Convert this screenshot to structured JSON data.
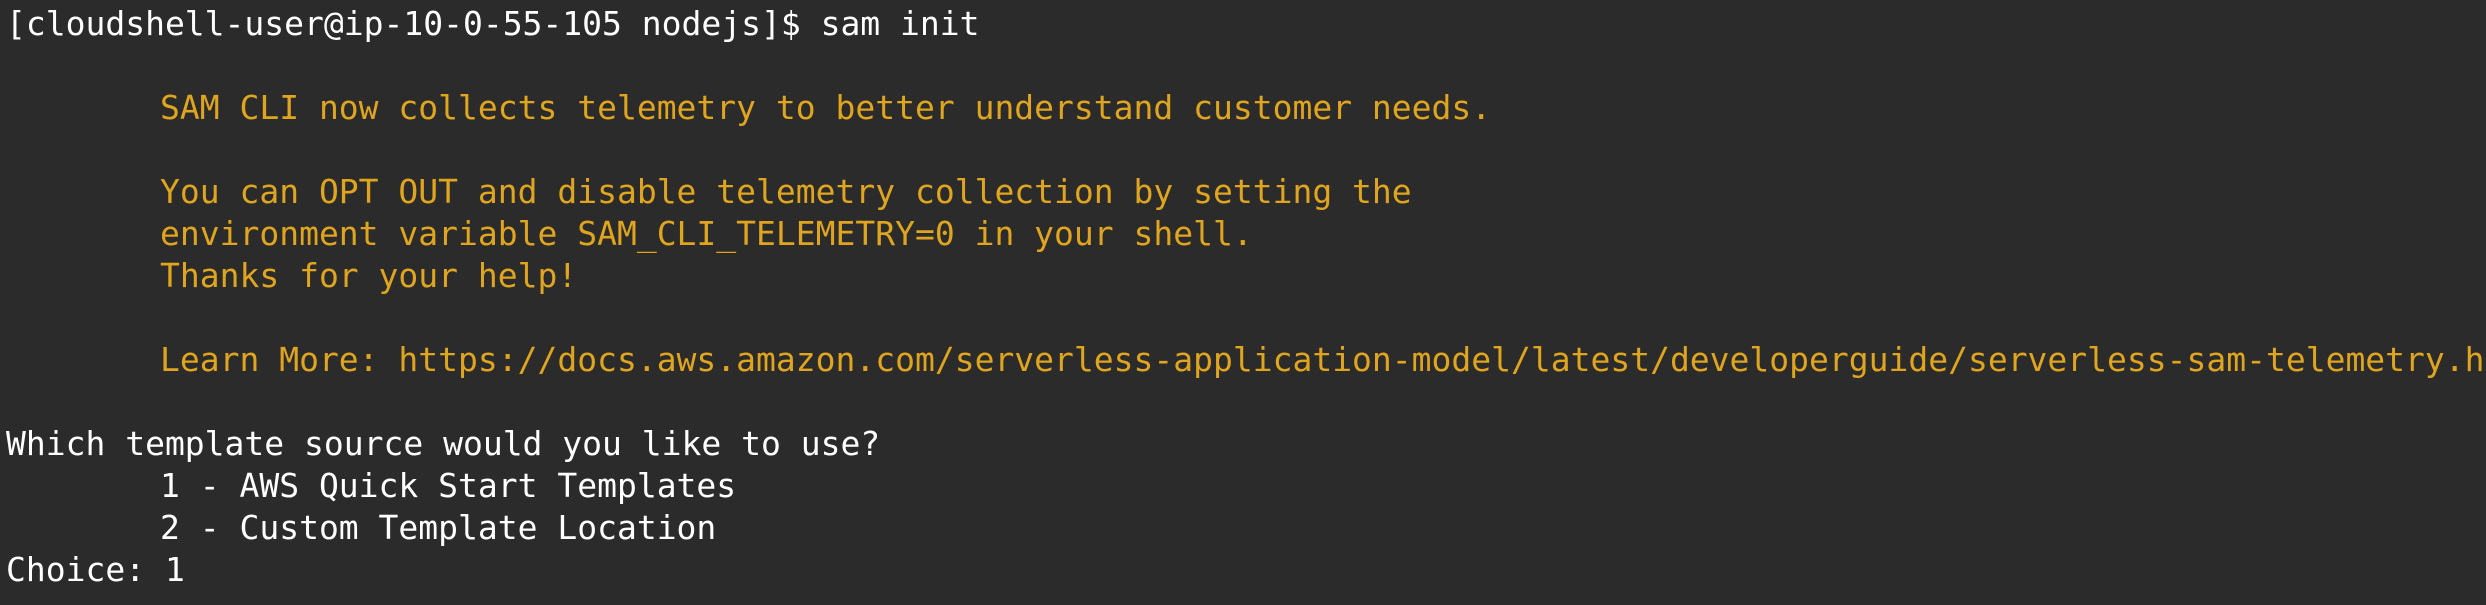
{
  "terminal": {
    "prompt_line": "[cloudshell-user@ip-10-0-55-105 nodejs]$ sam init",
    "telemetry": {
      "line1": "SAM CLI now collects telemetry to better understand customer needs.",
      "line2": "You can OPT OUT and disable telemetry collection by setting the",
      "line3": "environment variable SAM_CLI_TELEMETRY=0 in your shell.",
      "line4": "Thanks for your help!",
      "line5": "Learn More: https://docs.aws.amazon.com/serverless-application-model/latest/developerguide/serverless-sam-telemetry.html"
    },
    "question": "Which template source would you like to use?",
    "options": [
      "1 - AWS Quick Start Templates",
      "2 - Custom Template Location"
    ],
    "choice_line": "Choice: 1"
  },
  "colors": {
    "background": "#2b2b2b",
    "text": "#ffffff",
    "telemetry_text": "#e0a51e"
  }
}
